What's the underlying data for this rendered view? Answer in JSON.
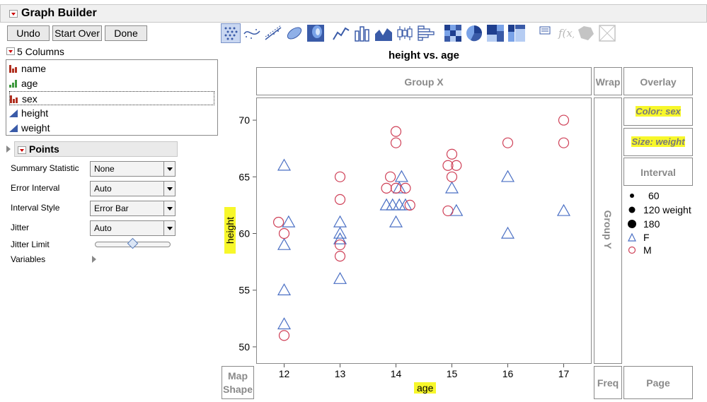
{
  "header": {
    "title": "Graph Builder"
  },
  "buttons": {
    "undo": "Undo",
    "start_over": "Start Over",
    "done": "Done"
  },
  "columns": {
    "header": "5 Columns",
    "items": [
      {
        "label": "name",
        "type": "nominal"
      },
      {
        "label": "age",
        "type": "ordinal"
      },
      {
        "label": "sex",
        "type": "nominal"
      },
      {
        "label": "height",
        "type": "continuous"
      },
      {
        "label": "weight",
        "type": "continuous"
      }
    ]
  },
  "points_panel": {
    "title": "Points",
    "summary_statistic": {
      "label": "Summary Statistic",
      "value": "None"
    },
    "error_interval": {
      "label": "Error Interval",
      "value": "Auto"
    },
    "interval_style": {
      "label": "Interval Style",
      "value": "Error Bar"
    },
    "jitter": {
      "label": "Jitter",
      "value": "Auto"
    },
    "jitter_limit": {
      "label": "Jitter Limit",
      "level": 0.5
    },
    "variables": {
      "label": "Variables"
    }
  },
  "zones": {
    "group_x": "Group X",
    "wrap": "Wrap",
    "overlay": "Overlay",
    "color": "Color: sex",
    "size": "Size: weight",
    "interval": "Interval",
    "group_y": "Group Y",
    "map_shape_1": "Map",
    "map_shape_2": "Shape",
    "freq": "Freq",
    "page": "Page"
  },
  "legend": {
    "sizes": [
      "60",
      "120 weight",
      "180"
    ],
    "markers": [
      {
        "label": "F",
        "color": "#4a6fc4"
      },
      {
        "label": "M",
        "color": "#cf4057"
      }
    ]
  },
  "chart_data": {
    "type": "scatter",
    "title": "height vs. age",
    "xlabel": "age",
    "ylabel": "height",
    "categories": [
      "12",
      "13",
      "14",
      "15",
      "16",
      "17"
    ],
    "ylim": [
      48.5,
      72
    ],
    "yticks": [
      "50",
      "55",
      "60",
      "65",
      "70"
    ],
    "grid": false,
    "legend_position": "right",
    "series": [
      {
        "name": "F",
        "marker": "triangle",
        "color": "#4a6fc4",
        "points": [
          {
            "x": 12,
            "y": 66
          },
          {
            "x": 12.08,
            "y": 61
          },
          {
            "x": 12,
            "y": 59
          },
          {
            "x": 12,
            "y": 55
          },
          {
            "x": 12,
            "y": 52
          },
          {
            "x": 13,
            "y": 61
          },
          {
            "x": 13,
            "y": 60
          },
          {
            "x": 13,
            "y": 59.5
          },
          {
            "x": 13,
            "y": 56
          },
          {
            "x": 14.1,
            "y": 65
          },
          {
            "x": 14.06,
            "y": 64
          },
          {
            "x": 13.83,
            "y": 62.5
          },
          {
            "x": 13.94,
            "y": 62.5
          },
          {
            "x": 14.06,
            "y": 62.5
          },
          {
            "x": 14.17,
            "y": 62.5
          },
          {
            "x": 14,
            "y": 61
          },
          {
            "x": 15,
            "y": 64
          },
          {
            "x": 15.08,
            "y": 62
          },
          {
            "x": 16,
            "y": 65
          },
          {
            "x": 16,
            "y": 60
          },
          {
            "x": 17,
            "y": 62
          }
        ]
      },
      {
        "name": "M",
        "marker": "circle",
        "color": "#cf4057",
        "points": [
          {
            "x": 11.9,
            "y": 61
          },
          {
            "x": 12,
            "y": 60
          },
          {
            "x": 12,
            "y": 51
          },
          {
            "x": 13,
            "y": 65
          },
          {
            "x": 13,
            "y": 63
          },
          {
            "x": 13,
            "y": 59
          },
          {
            "x": 13,
            "y": 58
          },
          {
            "x": 14,
            "y": 69
          },
          {
            "x": 14,
            "y": 68
          },
          {
            "x": 13.9,
            "y": 65
          },
          {
            "x": 13.83,
            "y": 64
          },
          {
            "x": 14,
            "y": 64
          },
          {
            "x": 14.17,
            "y": 64
          },
          {
            "x": 14.25,
            "y": 62.5
          },
          {
            "x": 15,
            "y": 67
          },
          {
            "x": 14.93,
            "y": 66
          },
          {
            "x": 15.08,
            "y": 66
          },
          {
            "x": 15,
            "y": 65
          },
          {
            "x": 14.93,
            "y": 62
          },
          {
            "x": 16,
            "y": 68
          },
          {
            "x": 17,
            "y": 70
          },
          {
            "x": 17,
            "y": 68
          }
        ]
      }
    ]
  }
}
